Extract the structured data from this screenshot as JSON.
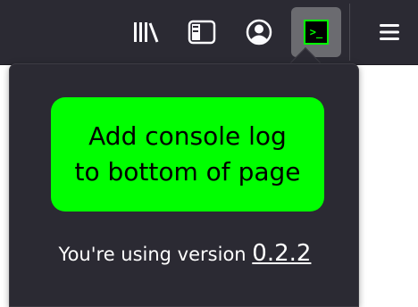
{
  "toolbar": {
    "icons": {
      "library": "library-icon",
      "sidebar": "sidebar-icon",
      "account": "account-icon",
      "extension": "console-log-extension-icon",
      "menu": "hamburger-menu-icon"
    },
    "extension_glyph": ">_"
  },
  "popup": {
    "action_button_label": "Add console log\nto bottom of page",
    "version_prefix": "You're using version ",
    "version_number": "0.2.2"
  },
  "colors": {
    "toolbar_bg": "#2b2a33",
    "popup_bg": "#2b2a33",
    "accent_green": "#00ff00",
    "text_white": "#ffffff",
    "page_bg": "#ffffff"
  }
}
